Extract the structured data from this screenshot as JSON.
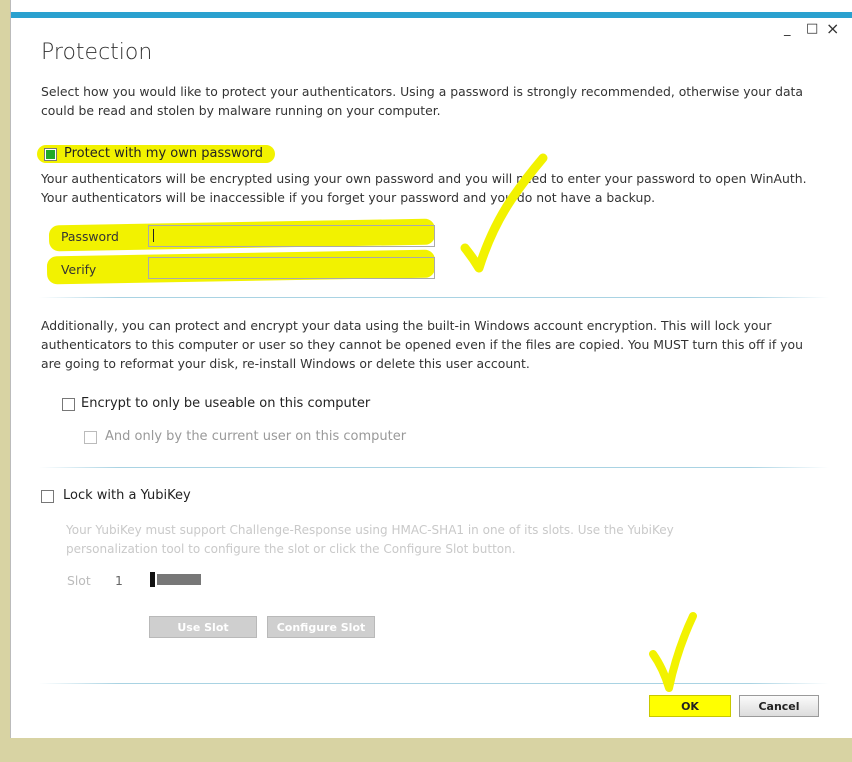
{
  "window": {
    "title": "Protection",
    "controls": {
      "minimize": "_",
      "maximize": "□",
      "close": "×"
    }
  },
  "intro": "Select how you would like to protect your authenticators. Using a password is strongly recommended, otherwise your data could be read and stolen by malware running on your computer.",
  "password_section": {
    "checkbox_label": "Protect with my own password",
    "checked": true,
    "description": "Your authenticators will be encrypted using your own password and you will need to enter your password to open WinAuth. Your authenticators will be inaccessible if you forget your password and you do not have a backup.",
    "password_label": "Password",
    "verify_label": "Verify",
    "password_value": "",
    "verify_value": ""
  },
  "windows_section": {
    "description": "Additionally, you can protect and encrypt your data using the built-in Windows account encryption. This will lock your authenticators to this computer or user so they cannot be opened even if the files are copied. You MUST turn this off if you are going to reformat your disk, re-install Windows or delete this user account.",
    "computer_label": "Encrypt to only be useable on this computer",
    "user_label": "And only by the current user on this computer"
  },
  "yubikey_section": {
    "checkbox_label": "Lock with a YubiKey",
    "description": "Your YubiKey must support Challenge-Response using HMAC-SHA1 in one of its slots. Use the YubiKey personalization tool to configure the slot or click the Configure Slot button.",
    "slot_label": "Slot",
    "slot_value": "1",
    "use_slot_button": "Use Slot",
    "configure_slot_button": "Configure Slot"
  },
  "footer": {
    "ok_button": "OK",
    "cancel_button": "Cancel"
  },
  "colors": {
    "accent": "#2aa1cf",
    "highlight": "#ffff00",
    "checked": "#1faa27"
  }
}
